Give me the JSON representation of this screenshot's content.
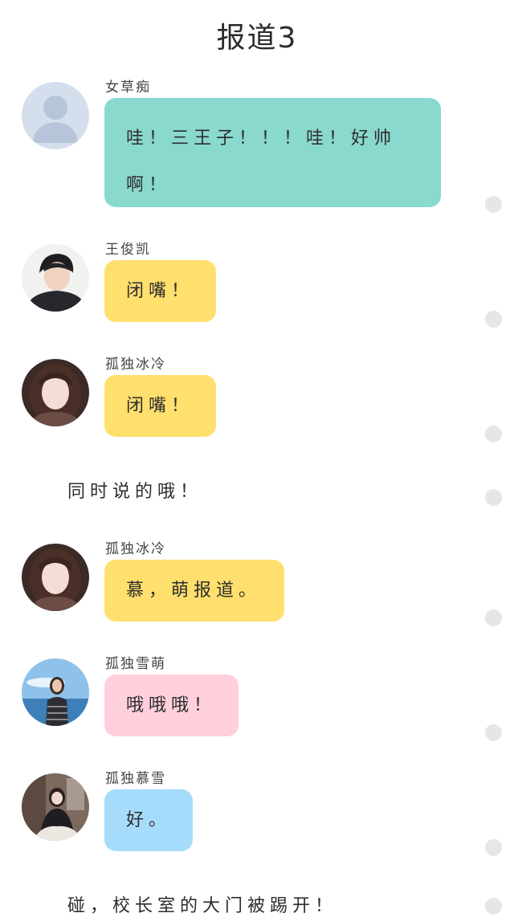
{
  "page": {
    "title": "报道3"
  },
  "messages": [
    {
      "sender": "女草痴",
      "text": "哇！三王子！！！哇！好帅啊！",
      "bubble_color": "#8ad9cf",
      "avatar": "default-avatar-icon"
    },
    {
      "sender": "王俊凯",
      "text": "闭嘴！",
      "bubble_color": "#ffdf6e",
      "avatar": "boy-avatar"
    },
    {
      "sender": "孤独冰冷",
      "text": "闭嘴！",
      "bubble_color": "#ffdf6e",
      "avatar": "girl-avatar"
    },
    {
      "sender": "孤独冰冷",
      "text": "慕，萌报道。",
      "bubble_color": "#ffdf6e",
      "avatar": "girl-avatar"
    },
    {
      "sender": "孤独雪萌",
      "text": "哦哦哦！",
      "bubble_color": "#ffd0dc",
      "avatar": "beach-girl-avatar"
    },
    {
      "sender": "孤独慕雪",
      "text": "好。",
      "bubble_color": "#a6dcfb",
      "avatar": "sitting-girl-avatar"
    }
  ],
  "narrations": [
    "同时说的哦！",
    "碰，校长室的大门被踢开！"
  ],
  "colors": {
    "teal_bubble": "#8ad9cf",
    "yellow_bubble": "#ffdf6e",
    "pink_bubble": "#ffd0dc",
    "blue_bubble": "#a6dcfb",
    "scroll_dot": "#e6e6e6"
  }
}
